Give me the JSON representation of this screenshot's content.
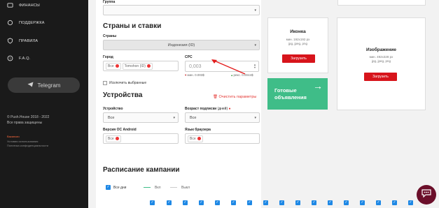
{
  "sidebar": {
    "items": [
      {
        "label": "ФИНАНСЫ",
        "icon": "wallet-icon"
      },
      {
        "label": "ПОДДЕРЖКА",
        "icon": "chat-icon"
      },
      {
        "label": "ПРАВИЛА",
        "icon": "shield-icon"
      },
      {
        "label": "F.A.Q.",
        "icon": "question-icon"
      }
    ],
    "telegram_label": "Telegram",
    "copyright_line1": "© Push.House 2018 - 2022",
    "copyright_line2": "Все права защищены",
    "links": [
      "Вакансии",
      "Условия использования",
      "Политика конфиденциальности"
    ]
  },
  "form": {
    "group_label": "Группа",
    "section_countries_title": "Страны и ставки",
    "country_label": "Страны",
    "country_value": "Индонезия (ID)",
    "city_label": "Город",
    "city_chips": [
      "Все",
      "Tomohon (ID)"
    ],
    "cpc_label": "CPC",
    "cpc_placeholder": "0,003",
    "cpc_min": "мин. 0.003$",
    "cpc_rec": "рекс. 0.0044$",
    "exclude_label": "Исключить выбранные",
    "section_devices_title": "Устройства",
    "clear_label": "Очистить параметры",
    "device_label": "Устройство",
    "device_value": "Все",
    "age_label": "Возраст подписки",
    "age_suffix": "(дней)",
    "age_value": "Все",
    "os_label": "Версия ОС Android",
    "os_chip": "Все",
    "lang_label": "Язык браузера",
    "lang_chip": "Все",
    "section_schedule_title": "Расписание кампании",
    "all_days_label": "Все дни",
    "legend_on": "Вкл",
    "legend_off": "Выкл"
  },
  "media": {
    "icon_title": "Иконка",
    "icon_sub1": "мин. 192x192 px",
    "icon_sub2": "jpg, jpeg, png",
    "icon_button": "Загрузить",
    "image_title": "Изображение",
    "image_sub1": "мин. 492x328 px",
    "image_sub2": "jpg, jpeg, png",
    "image_button": "Загрузить",
    "ready_label_1": "Готовые",
    "ready_label_2": "объявления"
  },
  "colors": {
    "accent_red": "#d7141b",
    "green": "#3fbd88",
    "sidebar_bg": "#1a1a1a",
    "checkbox_blue": "#1e88e5"
  }
}
